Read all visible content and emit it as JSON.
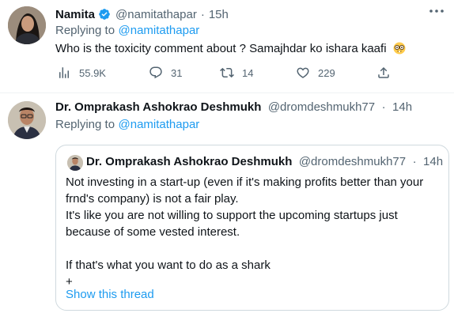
{
  "tweet1": {
    "author_name": "Namita",
    "author_handle": "@namitathapar",
    "separator": "·",
    "time": "15h",
    "replying_prefix": "Replying to",
    "replying_handle": "@namitathapar",
    "text": "Who is the toxicity comment about ? Samajhdar ko ishara kaafi",
    "emoji": "nerd-face-emoji",
    "stats": {
      "views": "55.9K",
      "replies": "31",
      "retweets": "14",
      "likes": "229"
    }
  },
  "tweet2": {
    "author_name": "Dr. Omprakash Ashokrao Deshmukh",
    "author_handle": "@dromdeshmukh77",
    "separator": "·",
    "time": "14h",
    "replying_prefix": "Replying to",
    "replying_handle": "@namitathapar"
  },
  "quote": {
    "author_name": "Dr. Omprakash Ashokrao Deshmukh",
    "author_handle": "@dromdeshmukh77",
    "separator": "·",
    "time": "14h",
    "text": "Not investing in a start-up (even if it's making profits better than your\nfrnd's company) is not a fair play.\nIt's like you are not willing to support the upcoming startups just\nbecause of some vested interest.\n\nIf that's what you want to do as a shark\n+",
    "show_thread": "Show this thread"
  },
  "colors": {
    "accent": "#1d9bf0",
    "muted": "#536471",
    "text": "#0f1419",
    "border": "#cfd9de"
  }
}
